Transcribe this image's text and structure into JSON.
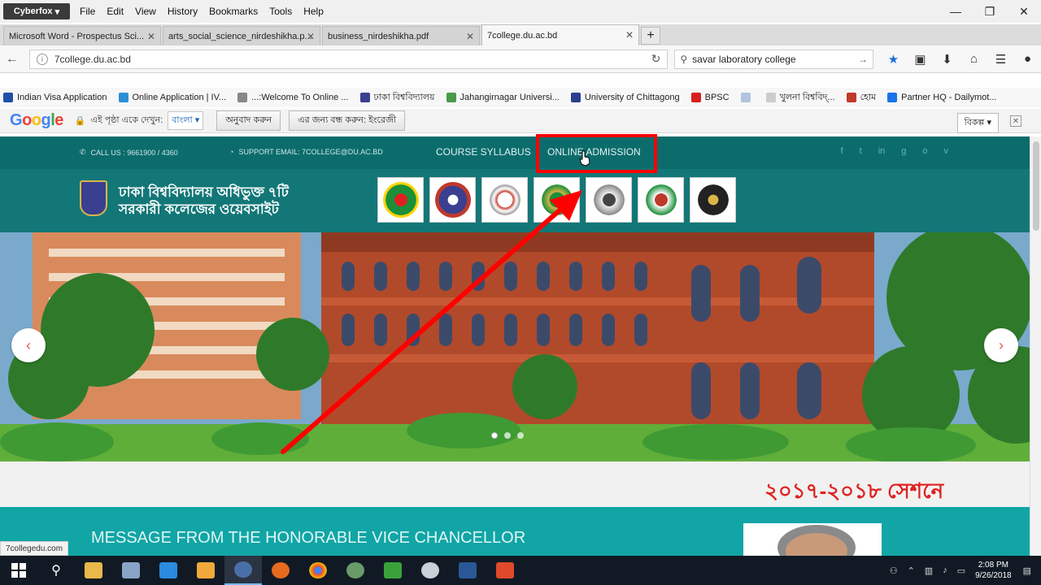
{
  "browser": {
    "brand": "Cyberfox",
    "menu": [
      "File",
      "Edit",
      "View",
      "History",
      "Bookmarks",
      "Tools",
      "Help"
    ],
    "tabs": [
      {
        "label": "Microsoft Word - Prospectus Sci..."
      },
      {
        "label": "arts_social_science_nirdeshikha.p..."
      },
      {
        "label": "business_nirdeshikha.pdf"
      },
      {
        "label": "7college.du.ac.bd"
      }
    ],
    "active_tab": 3,
    "url": "7college.du.ac.bd",
    "search_value": "savar laboratory college",
    "bookmarks": [
      {
        "label": "Indian Visa Application",
        "color": "#1f4fa8"
      },
      {
        "label": "Online Application | IV...",
        "color": "#2a8fd6"
      },
      {
        "label": "...:Welcome To Online ...",
        "color": "#888888"
      },
      {
        "label": "ঢাকা বিশ্ববিদ্যালয়",
        "color": "#3a3f8f"
      },
      {
        "label": "Jahangirnagar Universi...",
        "color": "#4a9a4a"
      },
      {
        "label": "University of Chittagong",
        "color": "#2a3f8f"
      },
      {
        "label": "BPSC",
        "color": "#d62020"
      },
      {
        "label": "",
        "color": "#b0c4de"
      },
      {
        "label": "খুলনা বিশ্ববিদ্...",
        "color": "#cccccc"
      },
      {
        "label": "হোম",
        "color": "#c0392b"
      },
      {
        "label": "Partner HQ - Dailymot...",
        "color": "#1a73e8"
      }
    ]
  },
  "translate_bar": {
    "prompt": "এই পৃষ্ঠা একে দেখুন:",
    "language": "বাংলা ▾",
    "translate_button": "অনুবাদ করুন",
    "never_button": "এর জন্য বন্ধ করুন: ইংরেজী",
    "options": "বিকল্প ▾",
    "close": "✕"
  },
  "site": {
    "call_us": "CALL US : 9661900 / 4360",
    "support_email": "SUPPORT EMAIL: 7COLLEGE@DU.AC.BD",
    "nav": [
      "COURSE SYLLABUS",
      "ONLINE ADMISSION"
    ],
    "title_line1": "ঢাকা বিশ্ববিদ্যালয় অধিভুক্ত ৭টি",
    "title_line2": "সরকারী কলেজের ওয়েবসাইট",
    "social_icons": [
      "f",
      "t",
      "in",
      "g",
      "o",
      "v"
    ],
    "session_text": "২০১৭-২০১৮ সেশনে",
    "vc_message": "MESSAGE FROM THE HONORABLE VICE CHANCELLOR",
    "slider_prev": "‹",
    "slider_next": "›"
  },
  "status_url": "7collegedu.com",
  "taskbar": {
    "clock_time": "2:08 PM",
    "clock_date": "9/26/2018"
  },
  "colors": {
    "teal_dark": "#0c6c6c",
    "teal": "#137777",
    "highlight": "#ff0000"
  }
}
